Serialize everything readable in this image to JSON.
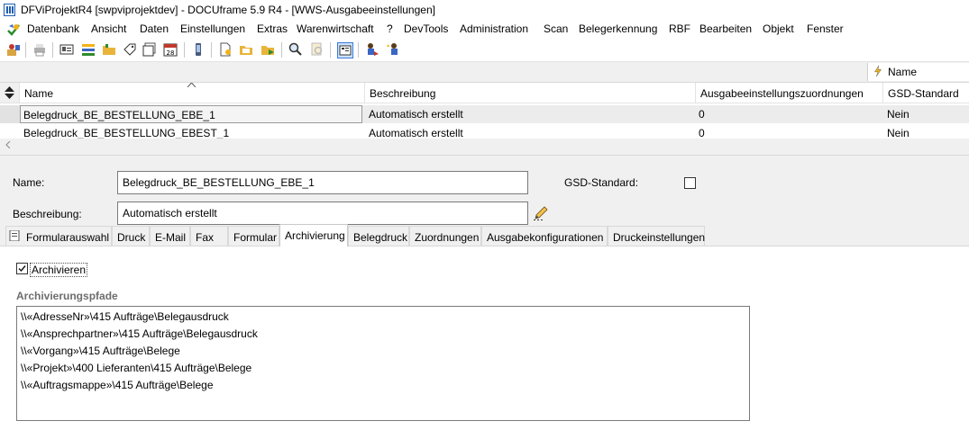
{
  "window": {
    "title": "DFViProjektR4 [swpviprojektdev] - DOCUframe 5.9 R4 - [WWS-Ausgabeeinstellungen]"
  },
  "menu": {
    "items": [
      "Datenbank",
      "Ansicht",
      "Daten",
      "Einstellungen",
      "Extras",
      "Warenwirtschaft",
      "?",
      "DevTools",
      "Administration",
      "Scan",
      "Belegerkennung",
      "RBF",
      "Bearbeiten",
      "Objekt",
      "Fenster"
    ]
  },
  "toolbar": {
    "icons": [
      "user-group-icon",
      "print-icon",
      "id-card-icon",
      "list-color-icon",
      "folder-icon",
      "tag-icon",
      "card-stack-icon",
      "calendar-icon",
      "mobile-icon",
      "document-new-icon",
      "folder-open-icon",
      "folder-add-icon",
      "search-icon",
      "search-doc-icon",
      "view-toggle-icon",
      "person-move-icon",
      "person-star-icon"
    ]
  },
  "grid": {
    "group_field": "Name",
    "columns": [
      "Name",
      "Beschreibung",
      "Ausgabeeinstellungszuordnungen",
      "GSD-Standard"
    ],
    "rows": [
      {
        "name": "Belegdruck_BE_BESTELLUNG_EBE_1",
        "beschreibung": "Automatisch erstellt",
        "zuordnungen": "0",
        "gsd": "Nein"
      },
      {
        "name": "Belegdruck_BE_BESTELLUNG_EBEST_1",
        "beschreibung": "Automatisch erstellt",
        "zuordnungen": "0",
        "gsd": "Nein"
      }
    ]
  },
  "form": {
    "name_label": "Name:",
    "name_value": "Belegdruck_BE_BESTELLUNG_EBE_1",
    "gsd_label": "GSD-Standard:",
    "gsd_checked": false,
    "beschreibung_label": "Beschreibung:",
    "beschreibung_value": "Automatisch erstellt"
  },
  "tabs": {
    "items": [
      "Formularauswahl",
      "Druck",
      "E-Mail",
      "Fax",
      "Formular",
      "Archivierung",
      "Belegdruck",
      "Zuordnungen",
      "Ausgabekonfigurationen",
      "Druckeinstellungen"
    ],
    "active": "Archivierung"
  },
  "archivierung": {
    "checkbox_label": "Archivieren",
    "checked": true,
    "section_title": "Archivierungspfade",
    "paths": [
      "\\\\«AdresseNr»\\415 Aufträge\\Belegausdruck",
      "\\\\«Ansprechpartner»\\415 Aufträge\\Belegausdruck",
      "\\\\«Vorgang»\\415 Aufträge\\Belege",
      "\\\\«Projekt»\\400 Lieferanten\\415 Aufträge\\Belege",
      "\\\\«Auftragsmappe»\\415 Aufträge\\Belege"
    ]
  }
}
